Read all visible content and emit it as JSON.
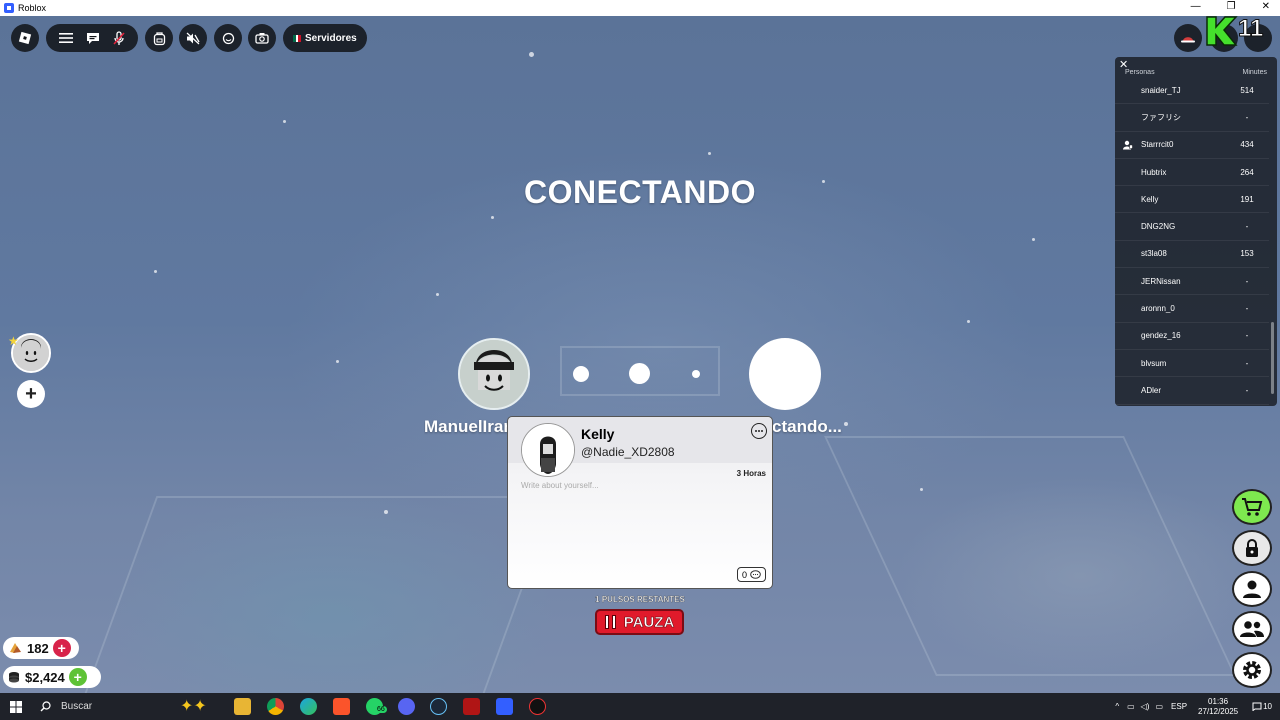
{
  "window": {
    "title": "Roblox"
  },
  "topbar": {
    "servers_label": "Servidores"
  },
  "topright": {
    "k_badge": "11"
  },
  "leaderboard": {
    "col_people": "Personas",
    "col_minutes": "Minutes",
    "rows": [
      {
        "name": "snaider_TJ",
        "minutes": "514"
      },
      {
        "name": "ファフリシ",
        "minutes": "-"
      },
      {
        "name": "Starrrcit0",
        "minutes": "434"
      },
      {
        "name": "Hubtrix",
        "minutes": "264"
      },
      {
        "name": "Kelly",
        "minutes": "191"
      },
      {
        "name": "DNG2NG",
        "minutes": "-"
      },
      {
        "name": "st3la08",
        "minutes": "153"
      },
      {
        "name": "JERNissan",
        "minutes": "-"
      },
      {
        "name": "aronnn_0",
        "minutes": "-"
      },
      {
        "name": "gendez_16",
        "minutes": "-"
      },
      {
        "name": "blvsum",
        "minutes": "-"
      },
      {
        "name": "ADler",
        "minutes": "-"
      }
    ]
  },
  "connect": {
    "title": "CONECTANDO",
    "left_label": "ManuelIran",
    "right_label": "ctando..."
  },
  "profile_card": {
    "name": "Kelly",
    "username": "@Nadie_XD2808",
    "time": "3 Horas",
    "bio_placeholder": "Write about yourself...",
    "comments": "0"
  },
  "pulsos_text": "1 PULSOS RESTANTES",
  "pause_label": "PAUZA",
  "currency": {
    "tokens": "182",
    "cash": "$2,424"
  },
  "taskbar": {
    "search_label": "Buscar",
    "whatsapp_badge": "66",
    "language": "ESP",
    "time": "01:36",
    "date": "27/12/2025",
    "notifications": "10"
  },
  "colors": {
    "cart_green": "#7ee84f",
    "pause_red": "#e11a2b",
    "cash_green": "#5ec236",
    "token_red": "#d8234a"
  }
}
